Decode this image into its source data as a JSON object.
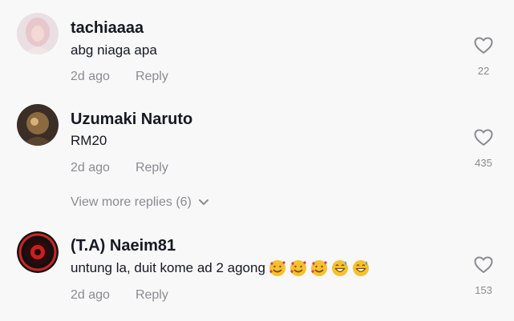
{
  "comments": [
    {
      "username": "tachiaaaa",
      "text": "abg niaga apa",
      "time": "2d ago",
      "reply_label": "Reply",
      "likes": "22",
      "avatar_icon": "profile-photo-woman"
    },
    {
      "username": "Uzumaki Naruto",
      "text": "RM20",
      "time": "2d ago",
      "reply_label": "Reply",
      "likes": "435",
      "avatar_icon": "profile-photo-dark"
    },
    {
      "username": "(T.A) Naeim81",
      "text": "untung la, duit kome ad 2 agong",
      "emojis": [
        "smiling-face-with-hearts",
        "smiling-face-with-hearts",
        "smiling-face-with-hearts",
        "grinning-face-with-sweat",
        "grinning-face-with-sweat"
      ],
      "time": "2d ago",
      "reply_label": "Reply",
      "likes": "153",
      "avatar_icon": "emblem-logo"
    }
  ],
  "view_more_replies": "View more replies (6)",
  "colors": {
    "background": "#f8f8f8",
    "text_primary": "#161823",
    "text_secondary": "#8a8b91",
    "emoji_yellow": "#f6c12c"
  }
}
